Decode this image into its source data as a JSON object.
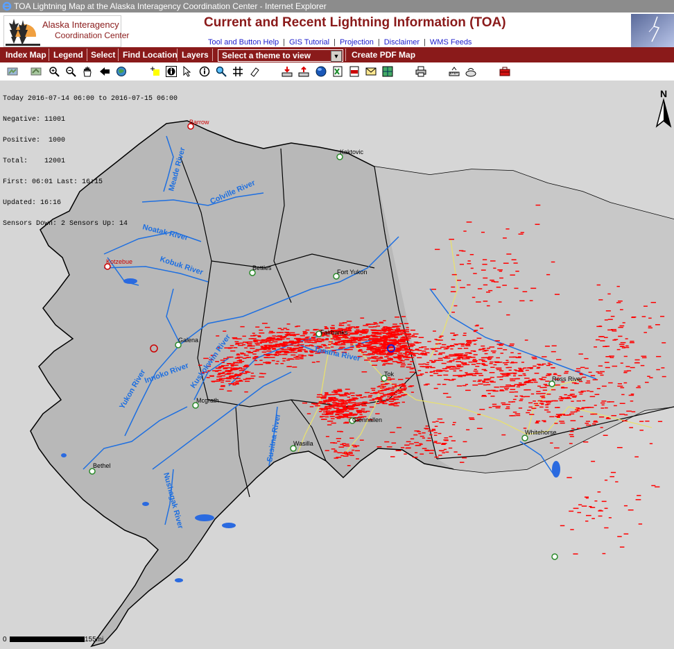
{
  "window": {
    "title": "TOA Lightning Map at the Alaska Interagency Coordination Center - Internet Explorer"
  },
  "logo": {
    "line1": "Alaska Interagency",
    "line2": "Coordination Center"
  },
  "header": {
    "title": "Current and Recent Lightning Information (TOA)",
    "links": [
      "Tool and Button Help",
      "GIS Tutorial",
      "Projection",
      "Disclaimer",
      "WMS Feeds"
    ]
  },
  "nav": {
    "index_map": "Index Map",
    "legend": "Legend",
    "select": "Select",
    "find_location": "Find Location",
    "layers": "Layers",
    "theme_select": "Select a theme to view",
    "create_pdf": "Create PDF Map"
  },
  "toolbar_icons": [
    "overview-map-icon",
    "full-extent-icon",
    "zoom-in-icon",
    "zoom-out-icon",
    "pan-hand-icon",
    "back-arrow-icon",
    "globe-refresh-icon",
    "select-box-icon",
    "identify-icon",
    "info-icon",
    "search-lens-icon",
    "grid-icon",
    "eraser-icon",
    "download-icon",
    "upload-icon",
    "blue-globe-icon",
    "excel-export-icon",
    "gml-export-icon",
    "email-icon",
    "image-export-icon",
    "print-icon",
    "measure-icon",
    "draw-icon",
    "toolbox-icon"
  ],
  "info_panel": {
    "line1": "Today 2016-07-14 06:00 to 2016-07-15 06:00",
    "line2": "Negative: 11001",
    "line3": "Positive:  1000",
    "line4": "Total:    12001",
    "line5": "First: 06:01 Last: 16:15",
    "line6": "Updated: 16:16",
    "line7": "Sensors Down: 2 Sensors Up: 14"
  },
  "map_labels": {
    "barrow": "Barrow",
    "kaktovic": "Kaktovic",
    "kotzebue": "Kotzebue",
    "bettles": "Bettles",
    "fort_yukon": "Fort Yukon",
    "fairbanks": "Fairbanks",
    "galena": "Galena",
    "tok": "Tok",
    "mcgrath": "Mcgrath",
    "glennallen": "Glennallen",
    "wasilla": "Wasilla",
    "bethel": "Bethel",
    "ross_river": "Ross River",
    "whitehorse": "Whitehorse",
    "meade_river": "Meade River",
    "colville_river": "Colville River",
    "noatak_river": "Noatak River",
    "kobuk_river": "Kobuk River",
    "yukon_river": "Yukon River",
    "innoko_river": "Innoko River",
    "kuskokwim_river": "Kuskokwim River",
    "tanana_river": "Tanana River",
    "susitna_river": "Susitna River",
    "nushagak_river": "Nushagak River"
  },
  "scale": {
    "zero": "0",
    "distance": "155mi"
  },
  "colors": {
    "brand": "#8a1a1a",
    "link": "#1a1acc",
    "strike": "#ff0000",
    "river": "#1e6fe0",
    "land": "#b8b8b8",
    "sea": "#d6d6d6",
    "road": "#e8e070"
  }
}
